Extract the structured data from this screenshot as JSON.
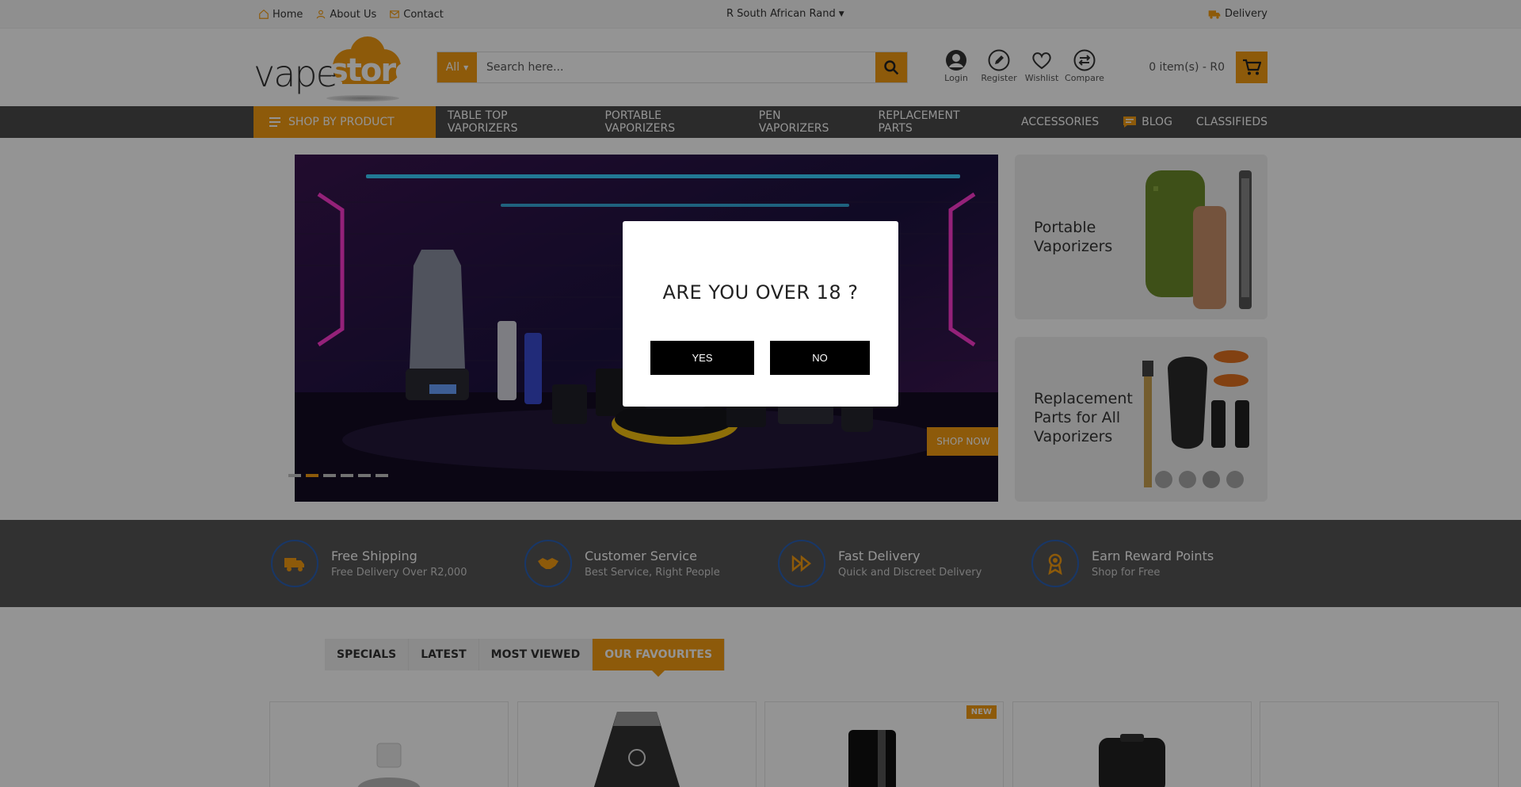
{
  "topbar": {
    "home": "Home",
    "about": "About Us",
    "contact": "Contact",
    "currency": "R South African Rand",
    "delivery": "Delivery"
  },
  "header": {
    "logo_part1": "vape",
    "logo_part2": "store",
    "search_category": "All",
    "search_placeholder": "Search here...",
    "icons": [
      {
        "label": "Login",
        "icon": "user-icon"
      },
      {
        "label": "Register",
        "icon": "pencil-icon"
      },
      {
        "label": "Wishlist",
        "icon": "heart-icon"
      },
      {
        "label": "Compare",
        "icon": "compare-arrows-icon"
      }
    ],
    "cart_text": "0 item(s) - R0"
  },
  "nav": {
    "shop_by": "SHOP BY PRODUCT",
    "items": [
      "TABLE TOP VAPORIZERS",
      "PORTABLE VAPORIZERS",
      "PEN VAPORIZERS",
      "REPLACEMENT PARTS",
      "ACCESSORIES",
      "BLOG",
      "CLASSIFIEDS"
    ]
  },
  "slider": {
    "cta": "SHOP NOW",
    "dot_count": 6,
    "active_dot": 1
  },
  "promos": [
    {
      "title": "Portable Vaporizers"
    },
    {
      "title": "Replacement Parts for All Vaporizers"
    }
  ],
  "features": [
    {
      "title": "Free Shipping",
      "subtitle": "Free Delivery Over R2,000",
      "icon": "truck-icon"
    },
    {
      "title": "Customer Service",
      "subtitle": "Best Service, Right People",
      "icon": "handshake-icon"
    },
    {
      "title": "Fast Delivery",
      "subtitle": "Quick and Discreet Delivery",
      "icon": "fast-forward-icon"
    },
    {
      "title": "Earn Reward Points",
      "subtitle": "Shop for Free",
      "icon": "award-icon"
    }
  ],
  "tabs": {
    "items": [
      "SPECIALS",
      "LATEST",
      "MOST VIEWED",
      "OUR FAVOURITES"
    ],
    "active": 3
  },
  "products": {
    "badge": "NEW"
  },
  "modal": {
    "question": "ARE YOU OVER 18 ?",
    "yes": "YES",
    "no": "NO"
  },
  "colors": {
    "accent": "#f39c12",
    "nav_bg": "#4a4a4a",
    "feature_bg": "#555555",
    "icon_circle": "#2a5fb3"
  }
}
